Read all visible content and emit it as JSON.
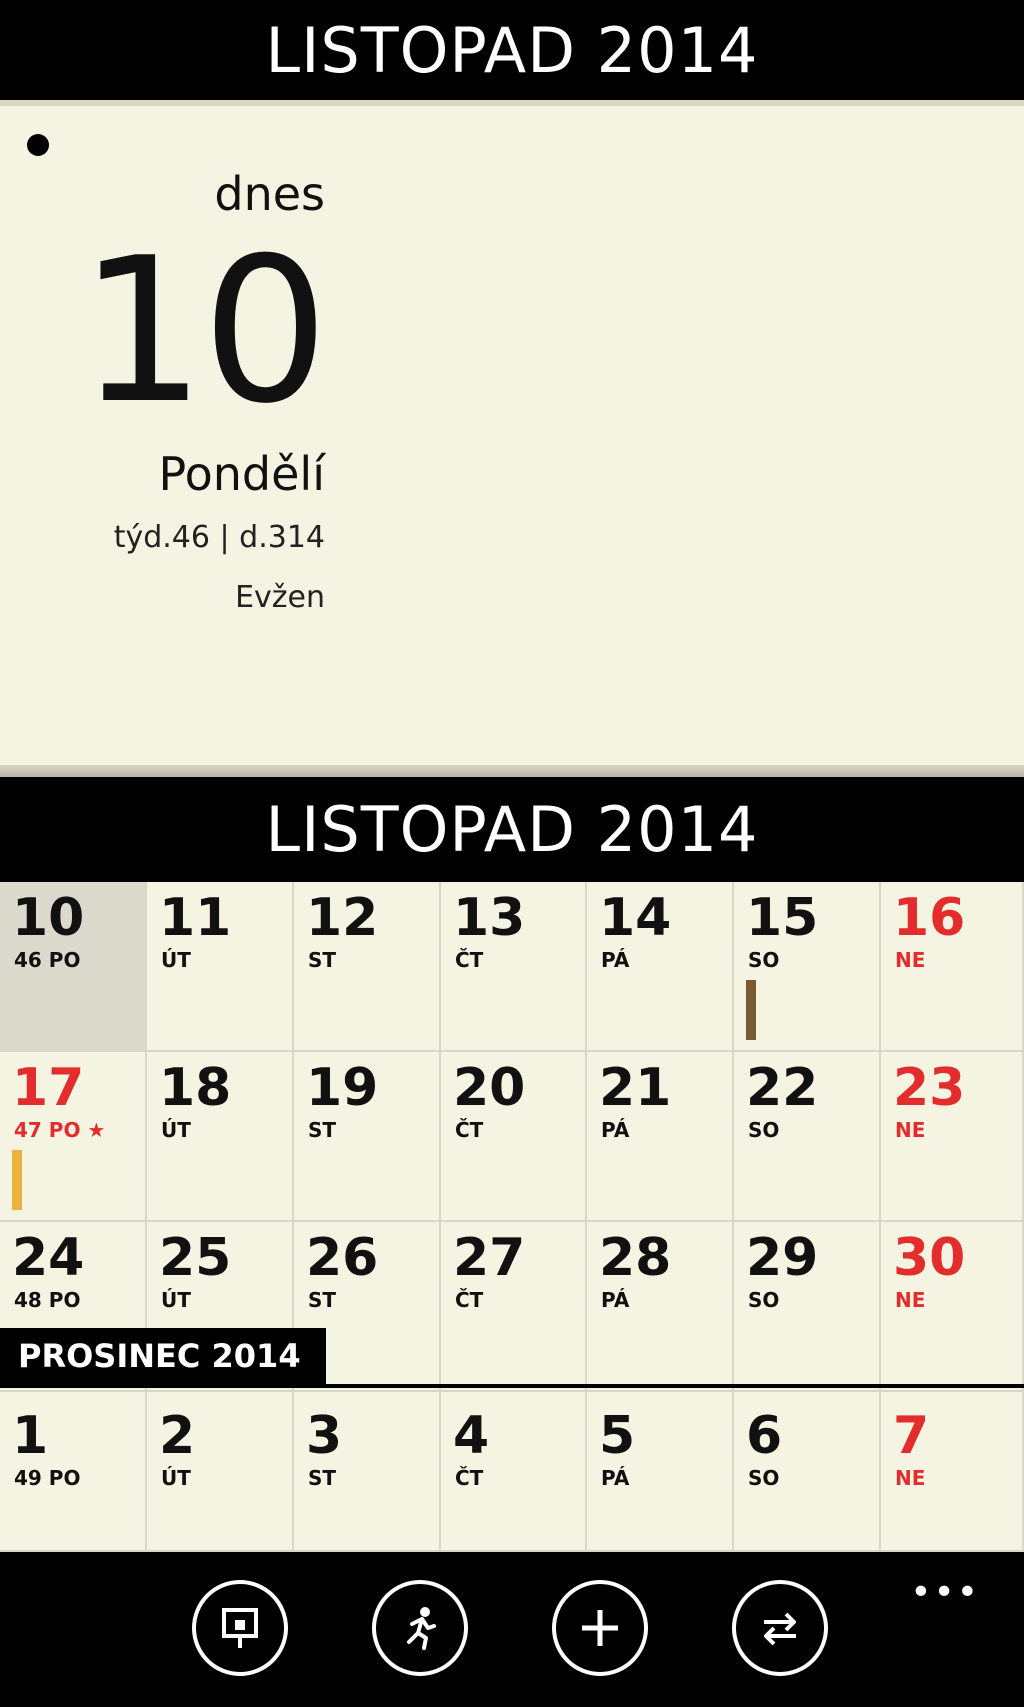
{
  "header": {
    "title": "LISTOPAD 2014"
  },
  "today": {
    "label": "dnes",
    "day_number": "10",
    "day_name": "Pondělí",
    "week_info": "týd.46 | d.314",
    "name_day": "Evžen"
  },
  "calendar": {
    "month_title": "LISTOPAD 2014",
    "next_month_title": "PROSINEC 2014",
    "weeks": [
      [
        {
          "num": "10",
          "label": "46 PO"
        },
        {
          "num": "11",
          "label": "ÚT"
        },
        {
          "num": "12",
          "label": "ST"
        },
        {
          "num": "13",
          "label": "ČT"
        },
        {
          "num": "14",
          "label": "PÁ"
        },
        {
          "num": "15",
          "label": "SO"
        },
        {
          "num": "16",
          "label": "NE"
        }
      ],
      [
        {
          "num": "17",
          "label": "47 PO ★"
        },
        {
          "num": "18",
          "label": "ÚT"
        },
        {
          "num": "19",
          "label": "ST"
        },
        {
          "num": "20",
          "label": "ČT"
        },
        {
          "num": "21",
          "label": "PÁ"
        },
        {
          "num": "22",
          "label": "SO"
        },
        {
          "num": "23",
          "label": "NE"
        }
      ],
      [
        {
          "num": "24",
          "label": "48 PO"
        },
        {
          "num": "25",
          "label": "ÚT"
        },
        {
          "num": "26",
          "label": "ST"
        },
        {
          "num": "27",
          "label": "ČT"
        },
        {
          "num": "28",
          "label": "PÁ"
        },
        {
          "num": "29",
          "label": "SO"
        },
        {
          "num": "30",
          "label": "NE"
        }
      ],
      [
        {
          "num": "1",
          "label": "49 PO"
        },
        {
          "num": "2",
          "label": "ÚT"
        },
        {
          "num": "3",
          "label": "ST"
        },
        {
          "num": "4",
          "label": "ČT"
        },
        {
          "num": "5",
          "label": "PÁ"
        },
        {
          "num": "6",
          "label": "SO"
        },
        {
          "num": "7",
          "label": "NE"
        }
      ]
    ],
    "colors": {
      "sunday": "#e32d2d",
      "today_bg": "#dcdacd",
      "event_brown": "#7a5a35",
      "event_yellow": "#e8b33a"
    }
  },
  "appbar": {
    "buttons": [
      {
        "icon": "presentation-icon"
      },
      {
        "icon": "running-person-icon"
      },
      {
        "icon": "plus-icon"
      },
      {
        "icon": "sync-arrows-icon"
      }
    ],
    "more": "•••"
  }
}
